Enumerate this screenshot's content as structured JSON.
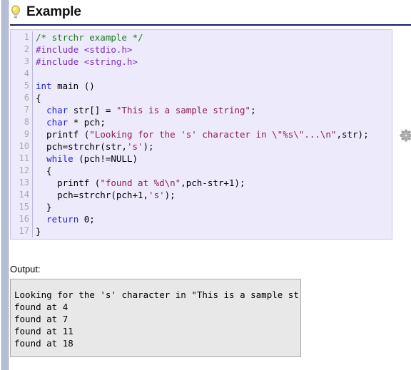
{
  "page": {
    "title": "Example",
    "bulb_icon": "lightbulb-icon",
    "accent_rule_color": "#191970",
    "rail_color": "#b3bdd4"
  },
  "code_block": {
    "background": "#eceafb",
    "border_color": "#c9c6e4",
    "gutter_color": "#aaaaaa",
    "gear_icon": "gear-icon",
    "line_numbers": [
      "1",
      "2",
      "3",
      "4",
      "5",
      "6",
      "7",
      "8",
      "9",
      "10",
      "11",
      "12",
      "13",
      "14",
      "15",
      "16",
      "17"
    ],
    "syntax_colors": {
      "comment": "#1f7a1f",
      "preprocessor": "#7d2fb8",
      "keyword": "#2323d6",
      "string": "#8e1f4f",
      "plain": "#000000"
    },
    "lines": [
      {
        "n": "1",
        "tokens": [
          {
            "t": "/* strchr example */",
            "c": "comment"
          }
        ]
      },
      {
        "n": "2",
        "tokens": [
          {
            "t": "#include <stdio.h>",
            "c": "pre"
          }
        ]
      },
      {
        "n": "3",
        "tokens": [
          {
            "t": "#include <string.h>",
            "c": "pre"
          }
        ]
      },
      {
        "n": "4",
        "tokens": [
          {
            "t": "",
            "c": "plain"
          }
        ]
      },
      {
        "n": "5",
        "tokens": [
          {
            "t": "int",
            "c": "kw"
          },
          {
            "t": " main ()",
            "c": "plain"
          }
        ]
      },
      {
        "n": "6",
        "tokens": [
          {
            "t": "{",
            "c": "plain"
          }
        ]
      },
      {
        "n": "7",
        "tokens": [
          {
            "t": "  ",
            "c": "plain"
          },
          {
            "t": "char",
            "c": "kw"
          },
          {
            "t": " str[] = ",
            "c": "plain"
          },
          {
            "t": "\"This is a sample string\"",
            "c": "str"
          },
          {
            "t": ";",
            "c": "plain"
          }
        ]
      },
      {
        "n": "8",
        "tokens": [
          {
            "t": "  ",
            "c": "plain"
          },
          {
            "t": "char",
            "c": "kw"
          },
          {
            "t": " * pch;",
            "c": "plain"
          }
        ]
      },
      {
        "n": "9",
        "tokens": [
          {
            "t": "  printf (",
            "c": "plain"
          },
          {
            "t": "\"Looking for the 's' character in \\\"%s\\\"...\\n\"",
            "c": "str"
          },
          {
            "t": ",str);",
            "c": "plain"
          }
        ]
      },
      {
        "n": "10",
        "tokens": [
          {
            "t": "  pch=strchr(str,",
            "c": "plain"
          },
          {
            "t": "'s'",
            "c": "str"
          },
          {
            "t": ");",
            "c": "plain"
          }
        ]
      },
      {
        "n": "11",
        "tokens": [
          {
            "t": "  ",
            "c": "plain"
          },
          {
            "t": "while",
            "c": "kw"
          },
          {
            "t": " (pch!=NULL)",
            "c": "plain"
          }
        ]
      },
      {
        "n": "12",
        "tokens": [
          {
            "t": "  {",
            "c": "plain"
          }
        ]
      },
      {
        "n": "13",
        "tokens": [
          {
            "t": "    printf (",
            "c": "plain"
          },
          {
            "t": "\"found at %d\\n\"",
            "c": "str"
          },
          {
            "t": ",pch-str+1);",
            "c": "plain"
          }
        ]
      },
      {
        "n": "14",
        "tokens": [
          {
            "t": "    pch=strchr(pch+1,",
            "c": "plain"
          },
          {
            "t": "'s'",
            "c": "str"
          },
          {
            "t": ");",
            "c": "plain"
          }
        ]
      },
      {
        "n": "15",
        "tokens": [
          {
            "t": "  }",
            "c": "plain"
          }
        ]
      },
      {
        "n": "16",
        "tokens": [
          {
            "t": "  ",
            "c": "plain"
          },
          {
            "t": "return",
            "c": "kw"
          },
          {
            "t": " 0;",
            "c": "plain"
          }
        ]
      },
      {
        "n": "17",
        "tokens": [
          {
            "t": "}",
            "c": "plain"
          }
        ]
      }
    ]
  },
  "output": {
    "label": "Output:",
    "background": "#e8e8e8",
    "border_color": "#a9a9a9",
    "lines": [
      "Looking for the 's' character in \"This is a sample string\"...",
      "found at 4",
      "found at 7",
      "found at 11",
      "found at 18"
    ]
  }
}
